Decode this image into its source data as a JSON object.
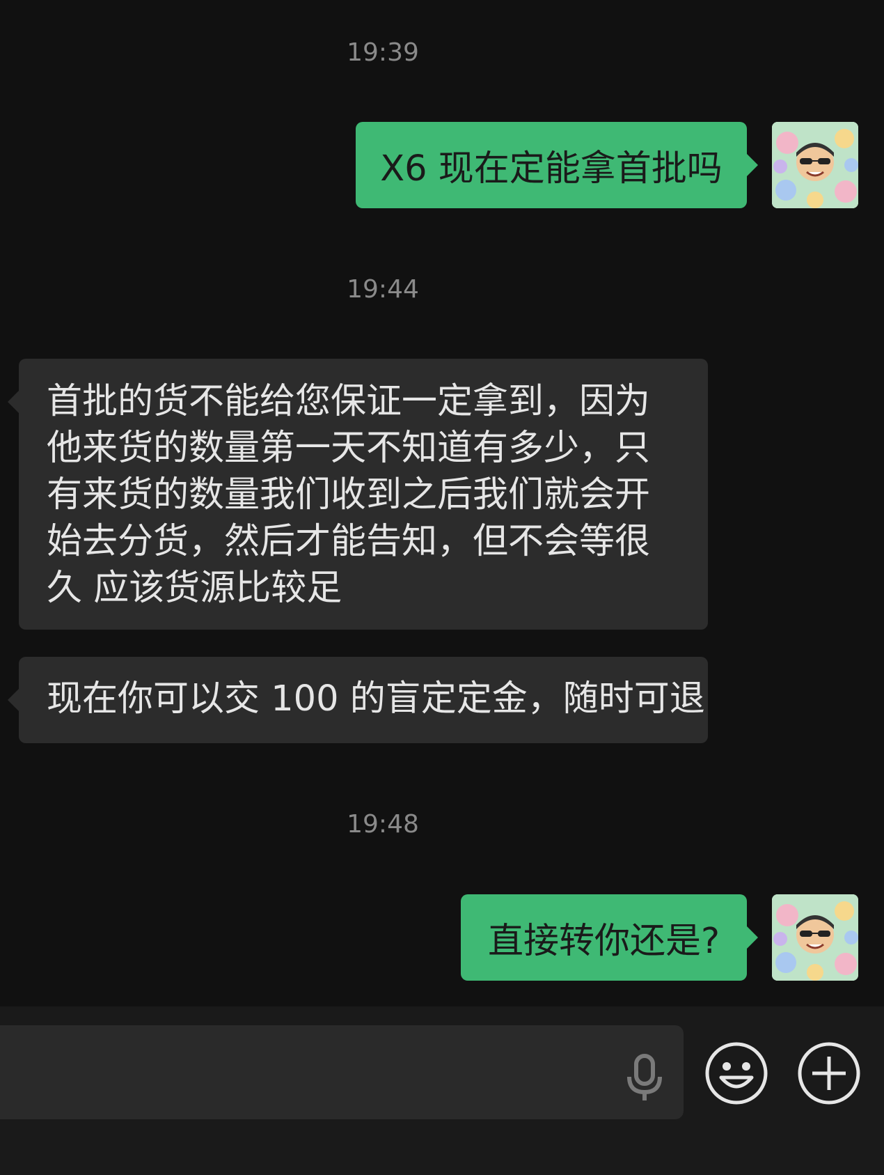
{
  "chat": {
    "messages": [
      {
        "type": "time",
        "text": "19:39"
      },
      {
        "type": "sent",
        "text": "X6 现在定能拿首批吗",
        "avatar_icon": "user-avatar-icon"
      },
      {
        "type": "time",
        "text": "19:44"
      },
      {
        "type": "received",
        "text": "首批的货不能给您保证一定拿到，因为他来货的数量第一天不知道有多少，只有来货的数量我们收到之后我们就会开始去分货，然后才能告知，但不会等很久 应该货源比较足"
      },
      {
        "type": "received",
        "text": "现在你可以交 100 的盲定定金，随时可退"
      },
      {
        "type": "time",
        "text": "19:48"
      },
      {
        "type": "sent",
        "text": "直接转你还是?",
        "avatar_icon": "user-avatar-icon"
      }
    ]
  },
  "input_bar": {
    "mic_icon": "microphone-icon",
    "emoji_icon": "emoji-icon",
    "more_icon": "plus-icon"
  },
  "colors": {
    "background": "#111111",
    "sent_bubble": "#3fb974",
    "received_bubble": "#2c2c2c",
    "timestamp": "#8a8a8a",
    "input_bar": "#1a1a1a",
    "input_field": "#2a2a2a"
  }
}
